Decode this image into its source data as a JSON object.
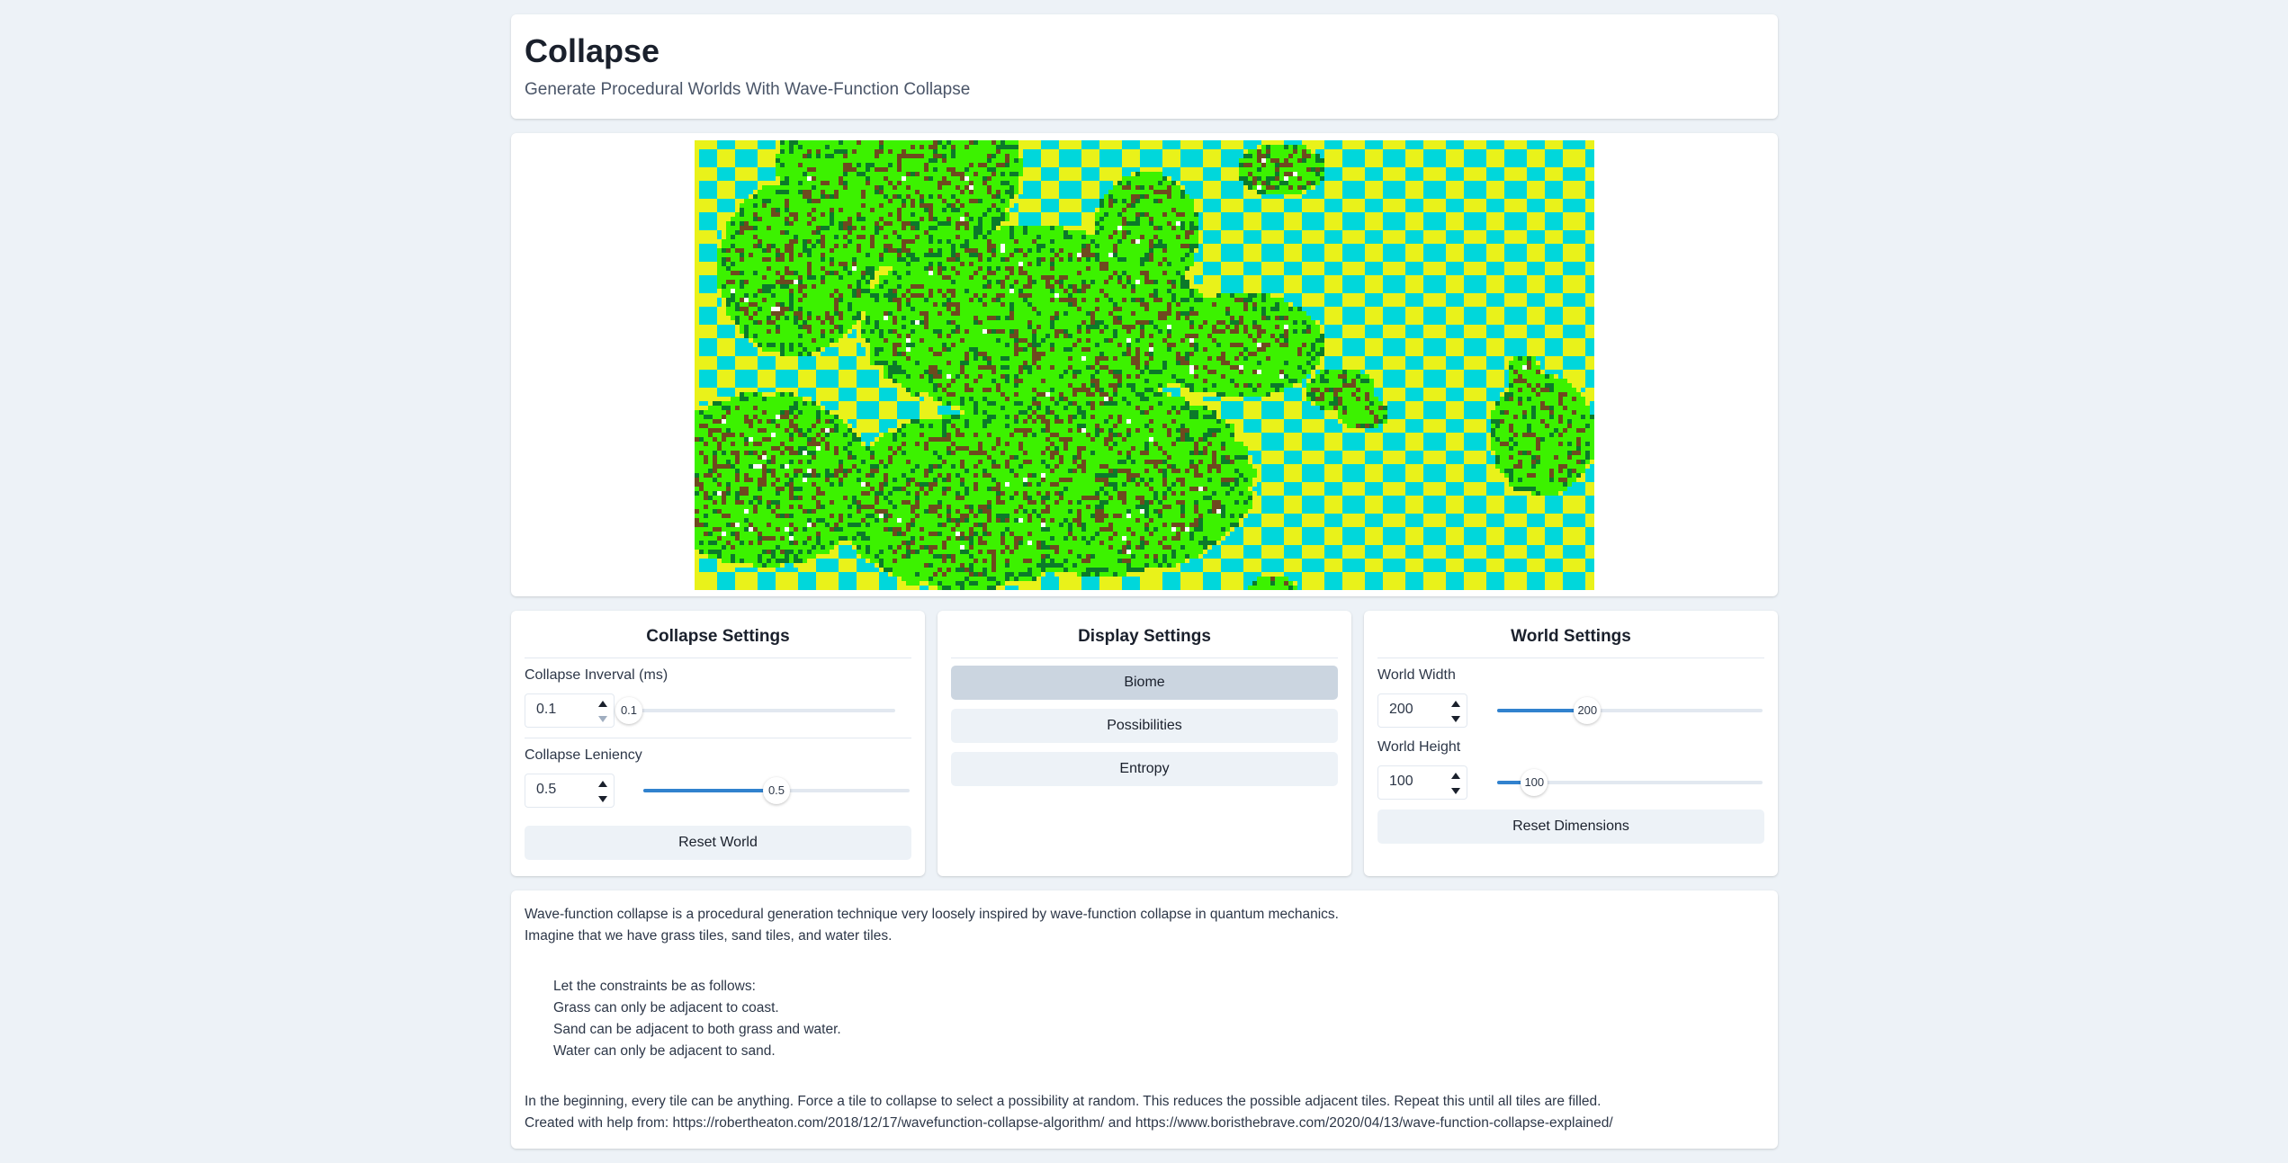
{
  "header": {
    "title": "Collapse",
    "subtitle": "Generate Procedural Worlds With Wave-Function Collapse"
  },
  "world": {
    "grid_width": 200,
    "grid_height": 100,
    "colors": {
      "deep_water": "#001a7a",
      "shallow_water": "#00d7db",
      "sand": "#e9f21a",
      "grass": "#3cf200",
      "forest": "#0b7a2a",
      "dirt": "#6e4a1f",
      "snow": "#ffffff"
    }
  },
  "collapse_settings": {
    "heading": "Collapse Settings",
    "interval_label": "Collapse Inverval (ms)",
    "interval_value": "0.1",
    "interval_slider_value": "0.1",
    "interval_fraction": 0.0,
    "leniency_label": "Collapse Leniency",
    "leniency_value": "0.5",
    "leniency_slider_value": "0.5",
    "leniency_fraction": 0.5,
    "reset_label": "Reset World"
  },
  "display_settings": {
    "heading": "Display Settings",
    "options": [
      "Biome",
      "Possibilities",
      "Entropy"
    ],
    "selected": "Biome"
  },
  "world_settings": {
    "heading": "World Settings",
    "width_label": "World Width",
    "width_value": "200",
    "width_slider_value": "200",
    "width_fraction": 0.34,
    "height_label": "World Height",
    "height_value": "100",
    "height_slider_value": "100",
    "height_fraction": 0.14,
    "reset_label": "Reset Dimensions"
  },
  "info": {
    "intro1": "Wave-function collapse is a procedural generation technique very loosely inspired by wave-function collapse in quantum mechanics.",
    "intro2": "Imagine that we have grass tiles, sand tiles, and water tiles.",
    "rules": [
      "Let the constraints be as follows:",
      "Grass can only be adjacent to coast.",
      "Sand can be adjacent to both grass and water.",
      "Water can only be adjacent to sand."
    ],
    "outro1": "In the beginning, every tile can be anything. Force a tile to collapse to select a possibility at random. This reduces the possible adjacent tiles. Repeat this until all tiles are filled.",
    "outro2": "Created with help from: https://robertheaton.com/2018/12/17/wavefunction-collapse-algorithm/ and https://www.boristhebrave.com/2020/04/13/wave-function-collapse-explained/"
  }
}
